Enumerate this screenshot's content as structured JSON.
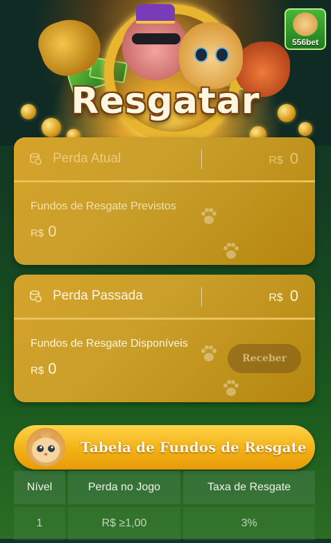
{
  "hero": {
    "title": "Resgatar",
    "brand_label": "556bet"
  },
  "current_loss": {
    "label": "Perda Atual",
    "currency": "R$",
    "amount": "0",
    "projected_label": "Fundos de Resgate Previstos",
    "projected_currency": "R$",
    "projected_amount": "0"
  },
  "past_loss": {
    "label": "Perda Passada",
    "currency": "R$",
    "amount": "0",
    "available_label": "Fundos de Resgate Disponíveis",
    "available_currency": "R$",
    "available_amount": "0",
    "receive_button": "Receber"
  },
  "rescue_table": {
    "title": "Tabela de Fundos de Resgate",
    "headers": [
      "Nível",
      "Perda no Jogo",
      "Taxa de Resgate"
    ],
    "rows": [
      [
        "1",
        "R$ ≥1,00",
        "3%"
      ]
    ]
  },
  "icons": {
    "coins": "coin-stack-icon",
    "paw": "paw-print-icon",
    "logo": "brand-logo-icon"
  },
  "colors": {
    "card_gold": "#caa02a",
    "banner_orange": "#f3b418",
    "background_green": "#143b22"
  }
}
